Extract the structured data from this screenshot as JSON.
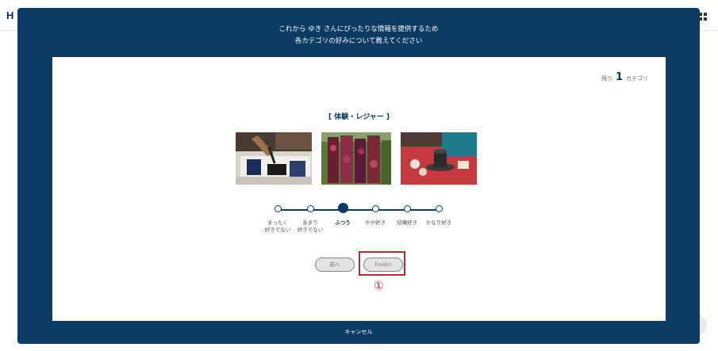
{
  "background": {
    "logo_text": "H"
  },
  "modal": {
    "intro_line1": "これから ゆき さんにぴったりな情報を提供するため",
    "intro_line2": "各カテゴリの好みについて教えてください",
    "remaining": {
      "prefix": "残り",
      "count": "1",
      "suffix": "カテゴリ"
    },
    "category_title": "[ 体験・レジャー ]",
    "photos": [
      {
        "name": "calligraphy-photo"
      },
      {
        "name": "dyed-fabric-photo"
      },
      {
        "name": "tea-ceremony-photo"
      }
    ],
    "scale": {
      "options": [
        {
          "line1": "まったく",
          "line2": "好きでない"
        },
        {
          "line1": "あまり",
          "line2": "好きでない"
        },
        {
          "line1": "ふつう",
          "line2": ""
        },
        {
          "line1": "やや好き",
          "line2": ""
        },
        {
          "line1": "結構好き",
          "line2": ""
        },
        {
          "line1": "かなり好き",
          "line2": ""
        }
      ],
      "selected_index": 2
    },
    "buttons": {
      "prev_label": "前へ",
      "finish_label": "Finish!"
    },
    "annotation_marker": "①",
    "cancel_label": "キャンセル"
  },
  "colors": {
    "modal_bg": "#0b3a63",
    "accent_red": "#c1272d"
  }
}
